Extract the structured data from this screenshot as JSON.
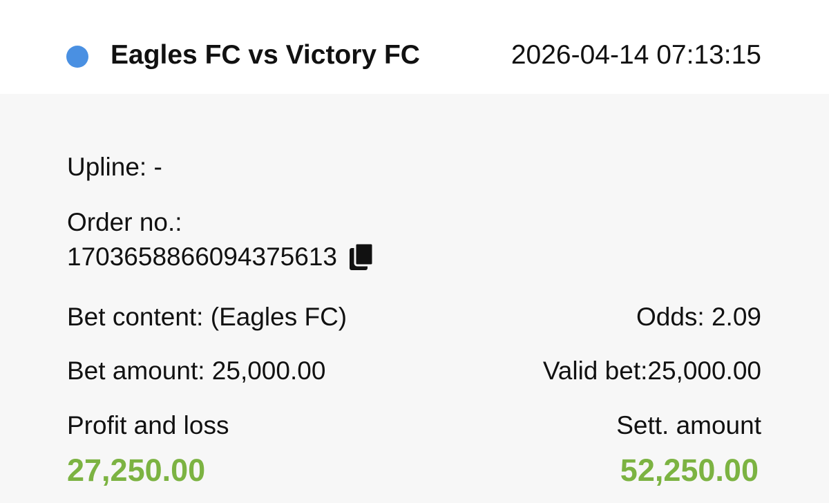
{
  "match": {
    "title": "Eagles FC vs Victory FC",
    "datetime": "2026-04-14 07:13:15",
    "status_color": "#4a90e2"
  },
  "details": {
    "upline": "Upline: -",
    "order_label": "Order no.:",
    "order_number": "1703658866094375613",
    "bet_content": "Bet content: (Eagles FC)",
    "odds": "Odds: 2.09",
    "bet_amount": "Bet amount: 25,000.00",
    "valid_bet": "Valid bet:25,000.00",
    "profit_label": "Profit and loss",
    "profit_value": "27,250.00",
    "settlement_label": "Sett. amount",
    "settlement_value": "52,250.00",
    "positive_color": "#7cb342"
  },
  "icons": {
    "copy": "copy-icon"
  }
}
